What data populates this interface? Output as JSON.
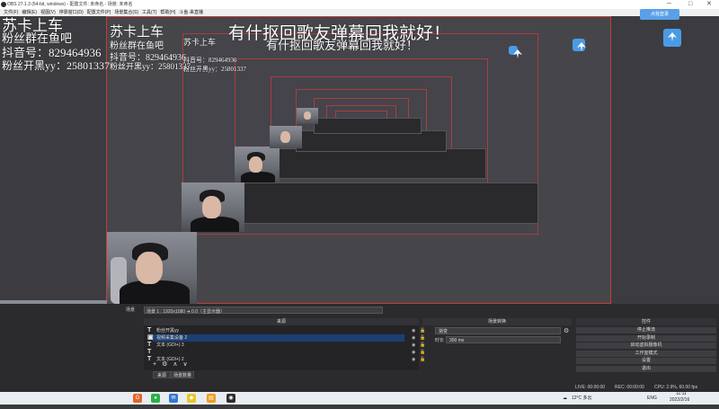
{
  "window": {
    "title": "OBS 27.1.3 (64-bit, windows) - 配置文件: 未命名 - 场景: 未命名",
    "minimize": "─",
    "maximize": "□",
    "close": "✕"
  },
  "menu": [
    "文件(F)",
    "编辑(E)",
    "视图(V)",
    "停靠窗口(D)",
    "配置文件(P)",
    "场景集合(S)",
    "工具(T)",
    "帮助(H)",
    "斗鱼·来直播"
  ],
  "login_button": "点我登录",
  "overlay": {
    "line1": "苏卡上车",
    "line2": "粉丝群在鱼吧",
    "line3": "抖音号：829464936",
    "line4": "粉丝开黑yy：25801337",
    "banner": "有什抠回歌友弹幕回我就好！",
    "banner2": "有什抠回歌友弹幕回我就好！"
  },
  "scene_bar": {
    "prefix": "场景",
    "selected": "场景 1 : 1920x1080 ➜ 0.0（主显示器）"
  },
  "sources_dock": {
    "title": "来源",
    "items": [
      {
        "icon": "T",
        "label": "粉丝开黑yy",
        "selected": false
      },
      {
        "icon": "▣",
        "label": "视频采集设备 2",
        "selected": true
      },
      {
        "icon": "T",
        "label": "文本 (GDI+) 3",
        "selected": false
      },
      {
        "icon": "T",
        "label": "",
        "selected": false
      },
      {
        "icon": "T",
        "label": "文本 (GDI+) 2",
        "selected": false
      }
    ],
    "footer_icons": [
      "+",
      "⚙",
      "∧",
      "∨"
    ],
    "tabs": [
      "来源",
      "场景数量"
    ]
  },
  "transitions_dock": {
    "title": "场景转换",
    "transition": "渐变",
    "duration_label": "时长",
    "duration_value": "300 ms"
  },
  "controls_dock": {
    "title": "控件",
    "buttons": [
      "停止推流",
      "开始录制",
      "启动虚拟摄像机",
      "工作室模式",
      "设置",
      "退出"
    ]
  },
  "status": {
    "live": "LIVE: 00:00:00",
    "rec": "REC: 00:00:00",
    "cpu": "CPU: 2.9%, 60.00 fps"
  },
  "taskbar": {
    "weather": "12°C 多云",
    "lang": "ENG",
    "time": "11:11",
    "date": "2022/2/16"
  },
  "colors": {
    "accent": "#4a9be6",
    "preview_border": "#c43c3c",
    "selected_row": "#1d3f73"
  }
}
